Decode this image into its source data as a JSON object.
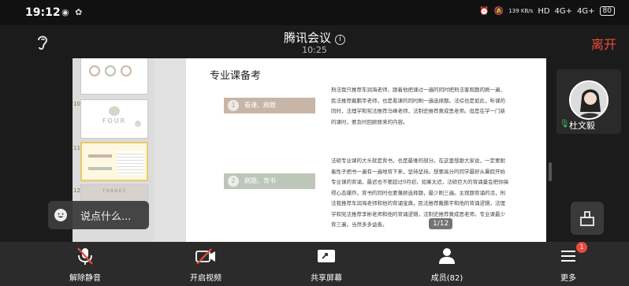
{
  "status_bar": {
    "time": "19:12",
    "speed": "139 KB/s",
    "network_hd": "HD",
    "network_1": "4G+",
    "network_2": "4G+",
    "battery": "80"
  },
  "header": {
    "title": "腾讯会议",
    "timer": "10:25",
    "leave_label": "离开"
  },
  "shared_screen": {
    "thumbnails": [
      {
        "num": ""
      },
      {
        "num": "10 ★",
        "caption": "FOUR"
      },
      {
        "num": "11 ★"
      },
      {
        "num": "12 ★",
        "caption": "THANKS"
      }
    ],
    "slide": {
      "title": "专业课备考",
      "sections": [
        {
          "num": "1",
          "label": "看课、刷题",
          "text": "刑法我只推荐车润海老师，跟着他把课过一遍的同时把刑法客观题的刷一遍，民法推荐戴鹏宇老师，也是看课的同时刷一遍选择题。法综也是如此，听课的同时，法理学和宪法推荐马峰老师，法制史推荐黄成思老师。但是在学一门新的课时，要及时回顾原来的内容。"
        },
        {
          "num": "2",
          "label": "刷题、背书",
          "text": "法硕专业课的大头就是背书，也是最难的部分。在这里想跟大家说，一定要耐着性子把书一遍有一遍地背下来，坚持坚持。想要高分的同学最好从暑假开始专业课的背诵，最迟也不要超过9月初，如果太迟，法硕巨大的背诵量会把你搞得心态爆炸。背书的同时也要兼顾选择题，最少刷三遍。主观题背诵的话，刑法我推荐车润海老师和他的背诵宝典，民法推荐戴鹏宇和他的背诵逻辑，法理学和宪法推荐李彬老师和他的背诵逻辑，法制史推荐黄成思老师。专业课最少背三遍，当然多多益善。"
        }
      ]
    },
    "page_indicator": "1/12"
  },
  "participant": {
    "name": "杜文毅"
  },
  "chat": {
    "placeholder": "说点什么..."
  },
  "toolbar": {
    "items": [
      {
        "label": "解除静音"
      },
      {
        "label": "开启视频"
      },
      {
        "label": "共享屏幕"
      },
      {
        "label": "成员(82)"
      },
      {
        "label": "更多",
        "badge": "1"
      }
    ]
  },
  "colors": {
    "leave": "#f04b3c",
    "accent_green": "#39c46a",
    "mute_red": "#e84a3d",
    "section_1": "#c7b5a8",
    "section_2": "#bcc7b9"
  }
}
